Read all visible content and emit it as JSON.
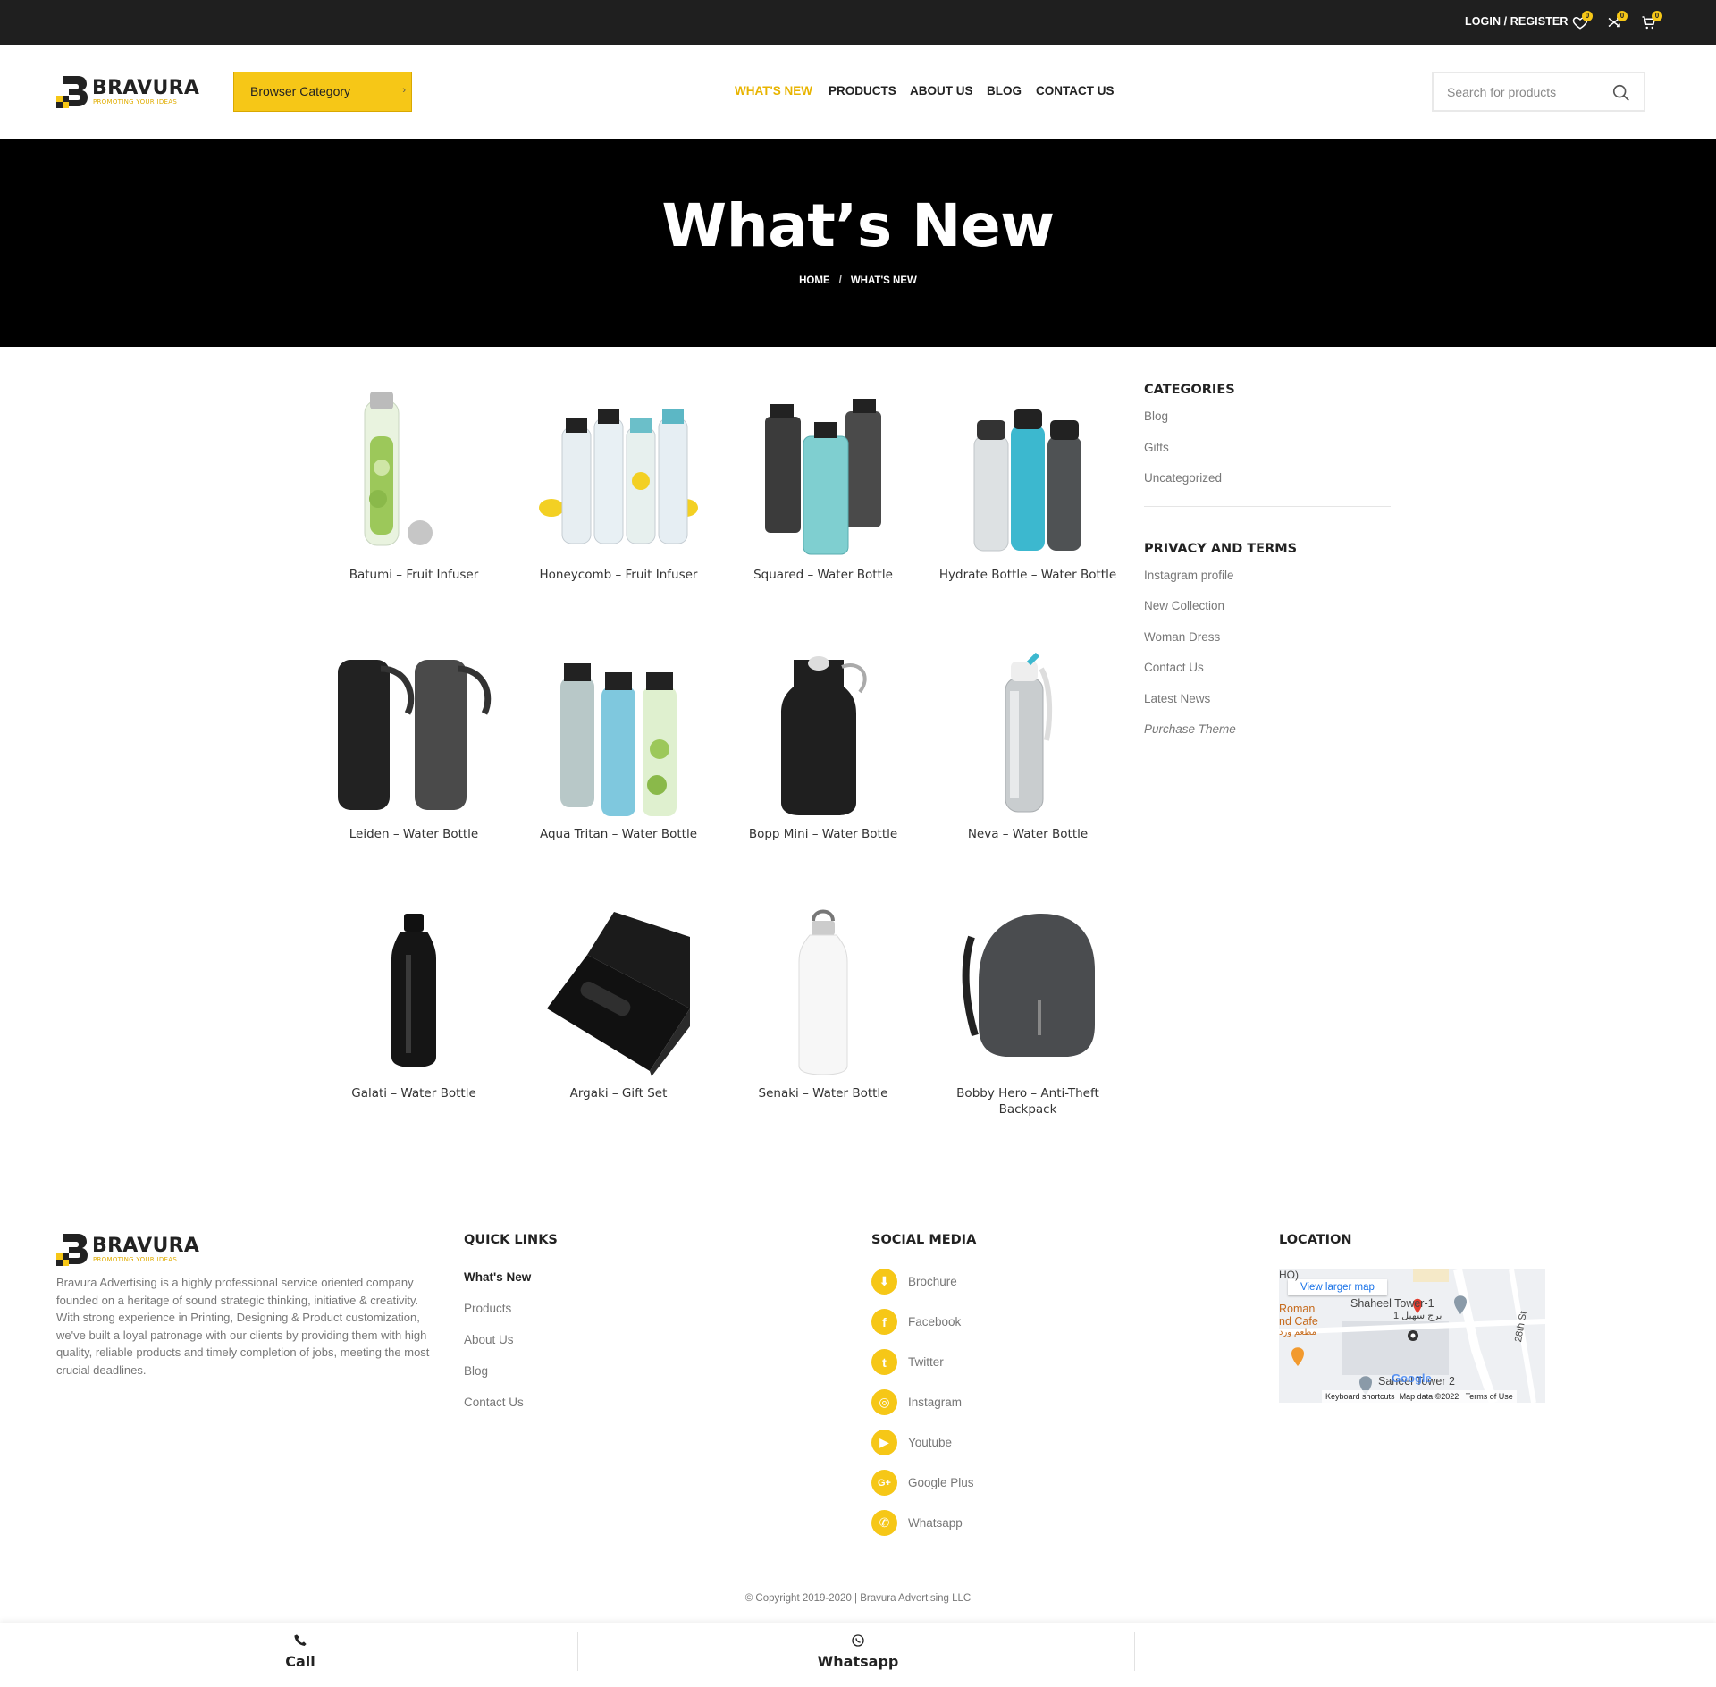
{
  "topbar": {
    "login_label": "LOGIN / REGISTER",
    "wishlist_count": "0",
    "compare_count": "0",
    "cart_count": "0"
  },
  "header": {
    "logo_text": "BRAVURA",
    "logo_tagline": "PROMOTING YOUR IDEAS",
    "category_button": "Browser Category",
    "nav": [
      "WHAT'S NEW",
      "PRODUCTS",
      "ABOUT US",
      "BLOG",
      "CONTACT US"
    ],
    "search_placeholder": "Search for products"
  },
  "hero": {
    "title": "What’s New",
    "breadcrumb": [
      "HOME",
      "WHAT'S NEW"
    ]
  },
  "products": [
    {
      "title": "Batumi – Fruit Infuser"
    },
    {
      "title": "Honeycomb – Fruit Infuser"
    },
    {
      "title": "Squared – Water Bottle"
    },
    {
      "title": "Hydrate Bottle – Water Bottle"
    },
    {
      "title": "Leiden – Water Bottle"
    },
    {
      "title": "Aqua Tritan – Water Bottle"
    },
    {
      "title": "Bopp Mini – Water Bottle"
    },
    {
      "title": "Neva – Water Bottle"
    },
    {
      "title": "Galati – Water Bottle"
    },
    {
      "title": "Argaki – Gift Set"
    },
    {
      "title": "Senaki – Water Bottle"
    },
    {
      "title": "Bobby Hero – Anti-Theft Backpack"
    }
  ],
  "sidebar": {
    "categories_title": "CATEGORIES",
    "categories": [
      "Blog",
      "Gifts",
      "Uncategorized"
    ],
    "privacy_title": "PRIVACY AND TERMS",
    "privacy_links": [
      "Instagram profile",
      "New Collection",
      "Woman Dress",
      "Contact Us",
      "Latest News",
      "Purchase Theme"
    ]
  },
  "footer": {
    "about": "Bravura Advertising is a highly professional service oriented company founded on a heritage of sound strategic thinking, initiative & creativity. With strong experience in Printing, Designing & Product customization, we've built a loyal patronage with our clients by providing them with high quality, reliable products and timely completion of jobs, meeting the most crucial deadlines.",
    "quick_links_title": "QUICK LINKS",
    "quick_links": [
      "What's New",
      "Products",
      "About Us",
      "Blog",
      "Contact Us"
    ],
    "social_title": "SOCIAL MEDIA",
    "social": [
      {
        "label": "Brochure",
        "icon": "download-icon"
      },
      {
        "label": "Facebook",
        "icon": "facebook-icon"
      },
      {
        "label": "Twitter",
        "icon": "twitter-icon"
      },
      {
        "label": "Instagram",
        "icon": "instagram-icon"
      },
      {
        "label": "Youtube",
        "icon": "youtube-icon"
      },
      {
        "label": "Google Plus",
        "icon": "google-plus-icon"
      },
      {
        "label": "Whatsapp",
        "icon": "whatsapp-icon"
      }
    ],
    "location_title": "LOCATION",
    "map": {
      "view_larger": "View larger map",
      "label_tower1": "Shaheel Tower-1",
      "label_tower1_ar": "برج سهيل 1",
      "label_cafe": "Roman",
      "label_cafe2": "nd Cafe",
      "label_cafe_ar": "مطعم ورد",
      "label_tower2": "Saheel Tower 2",
      "label_street": "28th St",
      "label_ho": "HO)",
      "google": "Google",
      "keyboard": "Keyboard shortcuts",
      "map_data": "Map data ©2022",
      "terms": "Terms of Use"
    },
    "copyright": "© Copyright 2019-2020 | Bravura Advertising LLC"
  },
  "bottom_bar": {
    "call_label": "Call",
    "whatsapp_label": "Whatsapp"
  },
  "colors": {
    "accent": "#f6c717",
    "dark": "#1f1f1f",
    "hero_bg": "#000000"
  }
}
